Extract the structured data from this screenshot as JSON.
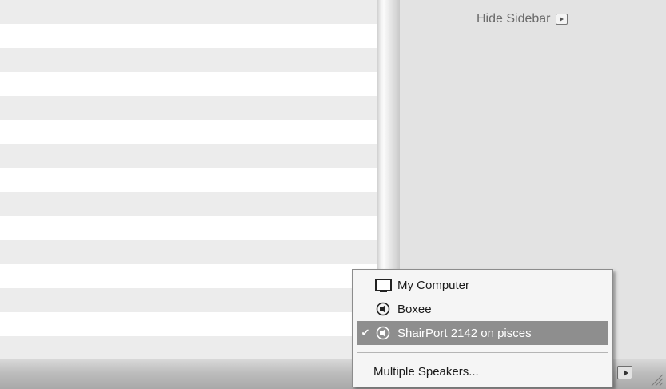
{
  "sidebar": {
    "hide_label": "Hide Sidebar",
    "hide_icon": "show-arrow-icon"
  },
  "speaker_menu": {
    "items": [
      {
        "label": "My Computer",
        "icon": "monitor-icon",
        "checked": false
      },
      {
        "label": "Boxee",
        "icon": "speaker-icon",
        "checked": false
      },
      {
        "label": "ShairPort 2142 on pisces",
        "icon": "speaker-icon",
        "checked": true,
        "check_mark": "✔"
      }
    ],
    "multiple_label": "Multiple Speakers..."
  },
  "bottom_bar": {
    "toggle_icon": "play-box-icon",
    "grip_icon": "resize-grip-icon"
  }
}
